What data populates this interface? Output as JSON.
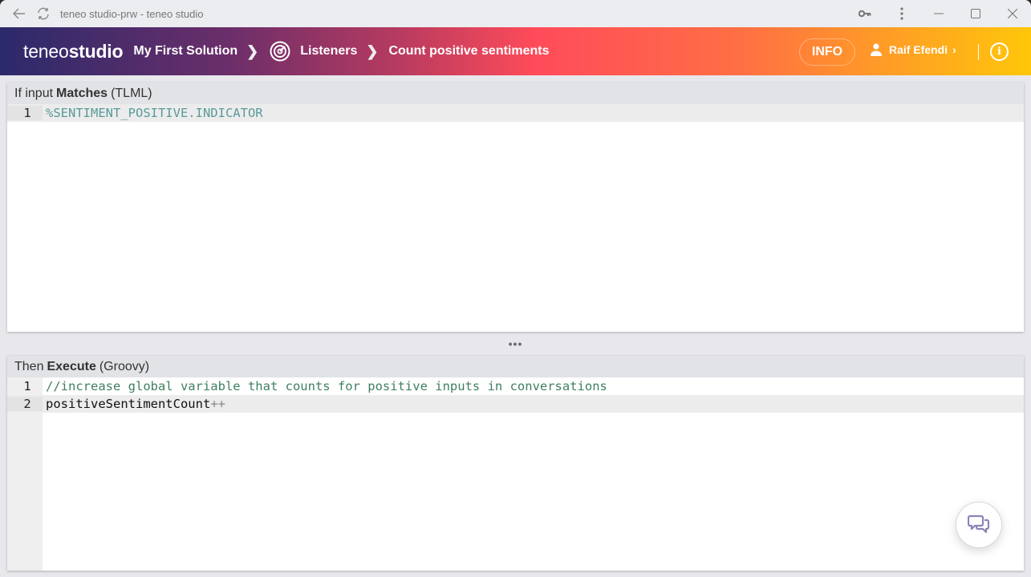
{
  "titlebar": {
    "title": "teneo studio-prw - teneo studio",
    "icons": [
      "back-arrow-icon",
      "reload-icon",
      "key-icon",
      "more-vert-icon",
      "minimize-icon",
      "maximize-icon",
      "close-icon"
    ]
  },
  "header": {
    "logo_light": "teneo",
    "logo_bold": "studio",
    "breadcrumb": [
      {
        "label": "My First Solution"
      },
      {
        "label": "Listeners",
        "icon": "radar-icon"
      },
      {
        "label": "Count positive sentiments"
      }
    ],
    "info_label": "INFO",
    "user_name": "Raif Efendi",
    "help_symbol": "i"
  },
  "condition_panel": {
    "prefix": "If input",
    "keyword": "Matches",
    "language": "(TLML)",
    "lines": [
      {
        "number": "1",
        "text": "%SENTIMENT_POSITIVE.INDICATOR"
      }
    ]
  },
  "splitter": {
    "label": "•••"
  },
  "execute_panel": {
    "prefix": "Then",
    "keyword": "Execute",
    "language": "(Groovy)",
    "lines": [
      {
        "number": "1",
        "text": "//increase global variable that counts for positive inputs in conversations"
      },
      {
        "number": "2",
        "ident": "positiveSentimentCount",
        "op": "++"
      }
    ]
  },
  "colors": {
    "tlml_text": "#5a9a9a",
    "comment_text": "#3f7f5f",
    "chat_icon": "#8c84b8"
  }
}
